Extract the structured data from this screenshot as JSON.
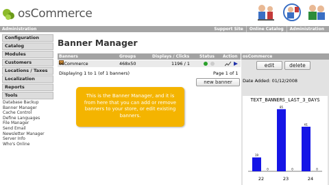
{
  "header": {
    "logo_text": "osCommerce"
  },
  "topbar": {
    "left": "Administration",
    "links": [
      "Support Site",
      "Online Catalog",
      "Administration"
    ]
  },
  "leftmenu": {
    "sections": [
      "Configuration",
      "Catalog",
      "Modules",
      "Customers",
      "Locations / Taxes",
      "Localization",
      "Reports",
      "Tools"
    ],
    "tools_items": [
      "Database Backup",
      "Banner Manager",
      "Cache Control",
      "Define Languages",
      "File Manager",
      "Send Email",
      "Newsletter Manager",
      "Server Info",
      "Who's Online"
    ]
  },
  "main": {
    "title": "Banner Manager",
    "columns": [
      "Banners",
      "Groups",
      "Displays / Clicks",
      "Status",
      "Action"
    ],
    "row": {
      "banner": "osCommerce",
      "group": "468x50",
      "displays_clicks": "1196 / 1"
    },
    "displaying": "Displaying 1 to 1 (of 1 banners)",
    "page_info": "Page 1 of 1",
    "new_banner_label": "new banner"
  },
  "callout": {
    "text": "This is the Banner Manager, and it is from here that you can add or remove banners to your store, or edit existing banners."
  },
  "rightpanel": {
    "heading": "osCommerce",
    "edit_label": "edit",
    "delete_label": "delete",
    "date_added": "Date Added: 01/12/2008"
  },
  "chart_data": {
    "type": "bar",
    "title": "TEXT_BANNERS_LAST_3_DAYS",
    "categories": [
      "22",
      "23",
      "24"
    ],
    "series": [
      {
        "values": [
          19,
          85,
          61
        ],
        "color": "#1515e6"
      },
      {
        "values": [
          0,
          0,
          0
        ],
        "color": "#1515e6"
      }
    ],
    "ylim": [
      0,
      90
    ]
  },
  "colors": {
    "accent": "#8cba2a",
    "callout": "#f4b400",
    "bar": "#1515e6",
    "header_bar": "#a3a3a3"
  }
}
